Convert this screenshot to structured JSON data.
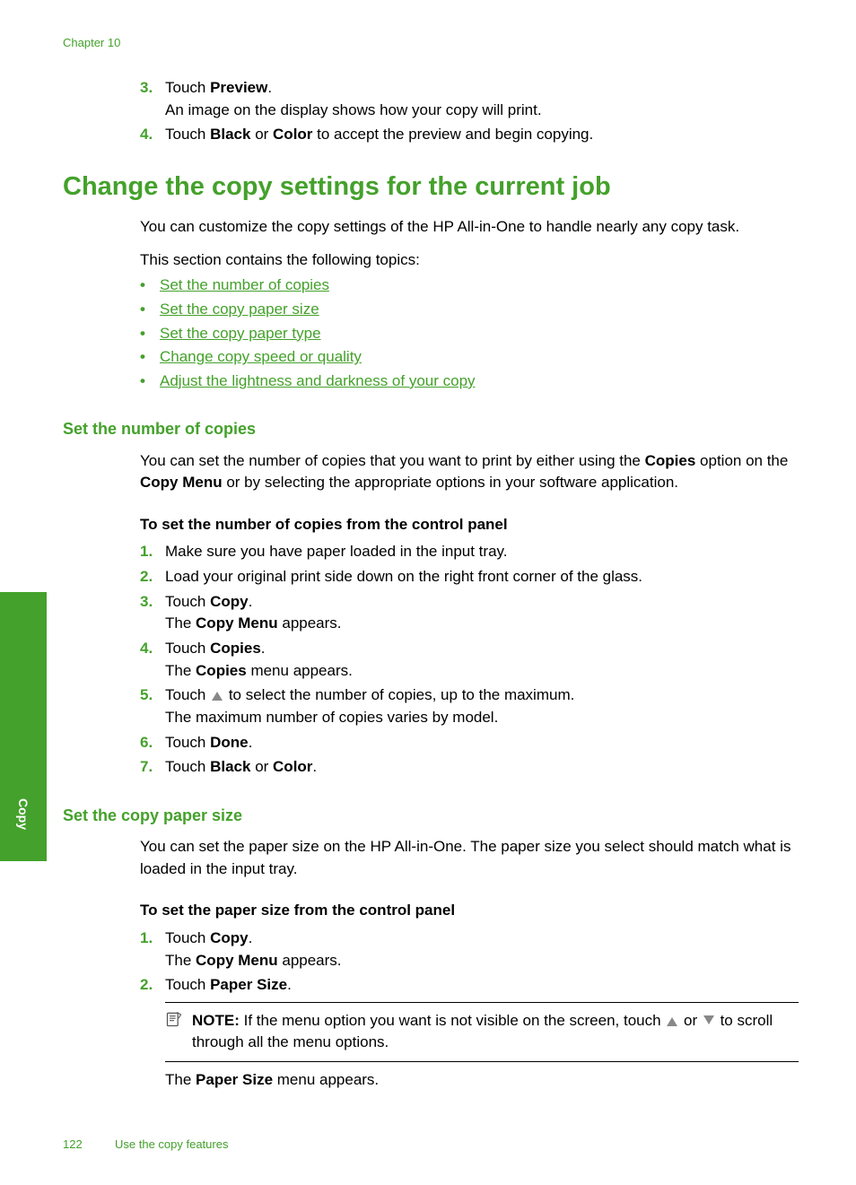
{
  "chapter": "Chapter 10",
  "intro_steps": {
    "s3": {
      "num": "3.",
      "t1": "Touch ",
      "t2": "Preview",
      "t3": ".",
      "sub": "An image on the display shows how your copy will print."
    },
    "s4": {
      "num": "4.",
      "t1": "Touch ",
      "t2": "Black",
      "t3": " or ",
      "t4": "Color",
      "t5": " to accept the preview and begin copying."
    }
  },
  "h1": "Change the copy settings for the current job",
  "p1": "You can customize the copy settings of the HP All-in-One to handle nearly any copy task.",
  "p2": "This section contains the following topics:",
  "toc": [
    "Set the number of copies",
    "Set the copy paper size",
    "Set the copy paper type",
    "Change copy speed or quality",
    "Adjust the lightness and darkness of your copy"
  ],
  "sec1": {
    "h": "Set the number of copies",
    "p": {
      "t1": "You can set the number of copies that you want to print by either using the ",
      "t2": "Copies",
      "t3": " option on the ",
      "t4": "Copy Menu",
      "t5": " or by selecting the appropriate options in your software application."
    },
    "sub": "To set the number of copies from the control panel",
    "steps": {
      "s1": {
        "num": "1.",
        "t": "Make sure you have paper loaded in the input tray."
      },
      "s2": {
        "num": "2.",
        "t": "Load your original print side down on the right front corner of the glass."
      },
      "s3": {
        "num": "3.",
        "t1": "Touch ",
        "t2": "Copy",
        "t3": ".",
        "sub1": "The ",
        "sub2": "Copy Menu",
        "sub3": " appears."
      },
      "s4": {
        "num": "4.",
        "t1": "Touch ",
        "t2": "Copies",
        "t3": ".",
        "sub1": "The ",
        "sub2": "Copies",
        "sub3": " menu appears."
      },
      "s5": {
        "num": "5.",
        "t1": "Touch ",
        "t2": " to select the number of copies, up to the maximum.",
        "sub": "The maximum number of copies varies by model."
      },
      "s6": {
        "num": "6.",
        "t1": "Touch ",
        "t2": "Done",
        "t3": "."
      },
      "s7": {
        "num": "7.",
        "t1": "Touch ",
        "t2": "Black",
        "t3": " or ",
        "t4": "Color",
        "t5": "."
      }
    }
  },
  "sec2": {
    "h": "Set the copy paper size",
    "p": "You can set the paper size on the HP All-in-One. The paper size you select should match what is loaded in the input tray.",
    "sub": "To set the paper size from the control panel",
    "steps": {
      "s1": {
        "num": "1.",
        "t1": "Touch ",
        "t2": "Copy",
        "t3": ".",
        "sub1": "The ",
        "sub2": "Copy Menu",
        "sub3": " appears."
      },
      "s2": {
        "num": "2.",
        "t1": "Touch ",
        "t2": "Paper Size",
        "t3": "."
      }
    },
    "note": {
      "label": "NOTE:",
      "t1": "  If the menu option you want is not visible on the screen, touch ",
      "t2": " or ",
      "t3": " to scroll through all the menu options."
    },
    "after": {
      "t1": "The ",
      "t2": "Paper Size",
      "t3": " menu appears."
    }
  },
  "side": "Copy",
  "footer": {
    "page": "122",
    "title": "Use the copy features"
  }
}
